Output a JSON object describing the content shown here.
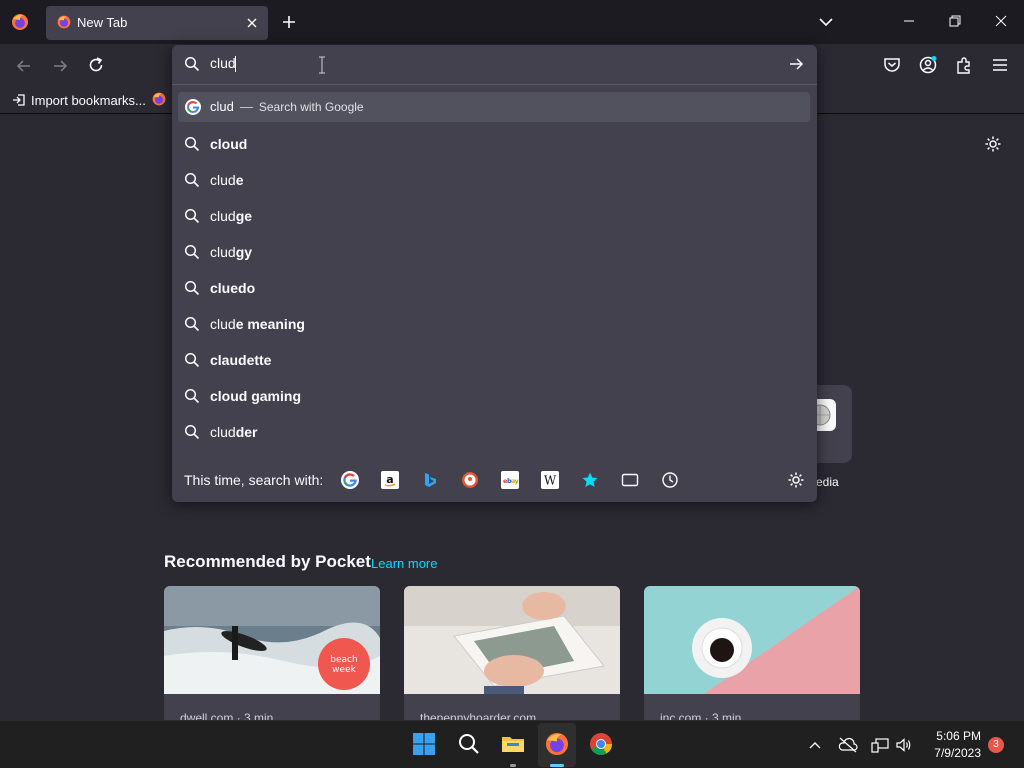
{
  "tab": {
    "title": "New Tab"
  },
  "bookmarks": {
    "import_label": "Import bookmarks..."
  },
  "urlbar": {
    "query": "clud",
    "selected": {
      "text": "clud",
      "action": "Search with Google"
    },
    "suggestions": [
      {
        "typed": "",
        "completion": "cloud"
      },
      {
        "typed": "clud",
        "completion": "e"
      },
      {
        "typed": "clud",
        "completion": "ge"
      },
      {
        "typed": "clud",
        "completion": "gy"
      },
      {
        "typed": "",
        "completion": "cluedo"
      },
      {
        "typed": "clud",
        "completion": "e meaning"
      },
      {
        "typed": "",
        "completion": "claudette"
      },
      {
        "typed": "",
        "completion": "cloud gaming"
      },
      {
        "typed": "clud",
        "completion": "der"
      }
    ],
    "oneoff_label": "This time, search with:",
    "engines": [
      "google-icon",
      "amazon-icon",
      "bing-icon",
      "duckduckgo-icon",
      "ebay-icon",
      "wikipedia-icon",
      "bookmarks-icon",
      "tabs-icon",
      "history-icon"
    ]
  },
  "shortcut": {
    "label": "edia"
  },
  "pocket": {
    "heading": "Recommended by Pocket",
    "learn_more": "Learn more",
    "cards": [
      {
        "source": "dwell.com · 3 min"
      },
      {
        "source": "thepennyhoarder.com"
      },
      {
        "source": "inc.com · 3 min"
      }
    ]
  },
  "taskbar": {
    "time": "5:06 PM",
    "date": "7/9/2023",
    "notification_count": "3"
  },
  "colors": {
    "accent": "#00ddff",
    "urlbar_bg": "#42414d",
    "page_bg": "#2b2a33",
    "tab_strip": "#1c1b22"
  }
}
